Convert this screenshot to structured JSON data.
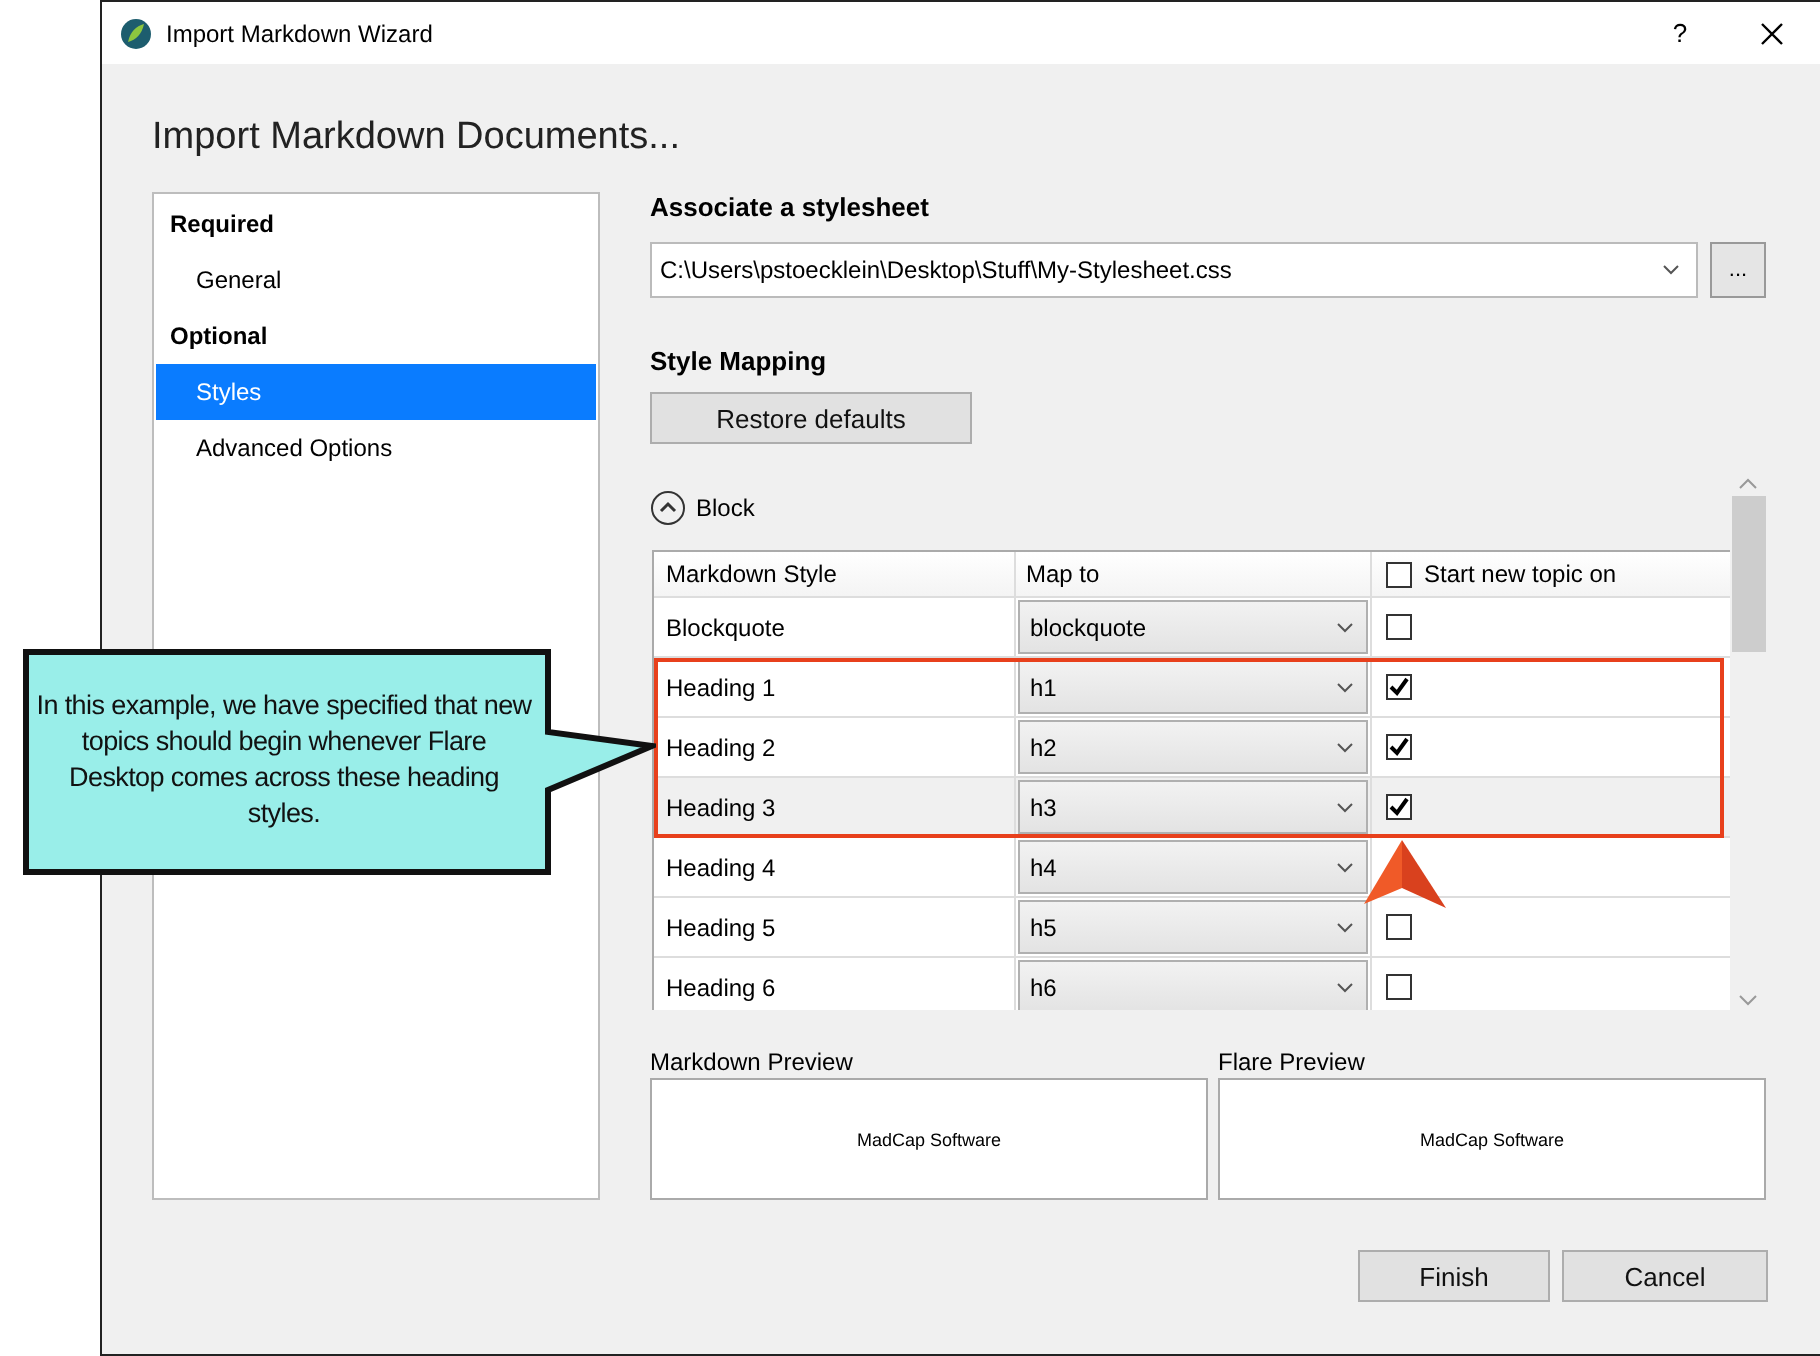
{
  "window": {
    "title": "Import Markdown Wizard",
    "help_button": "?"
  },
  "heading": "Import Markdown Documents...",
  "sidebar": {
    "groups": [
      {
        "label": "Required",
        "items": [
          {
            "label": "General",
            "selected": false
          }
        ]
      },
      {
        "label": "Optional",
        "items": [
          {
            "label": "Styles",
            "selected": true
          },
          {
            "label": "Advanced Options",
            "selected": false
          }
        ]
      }
    ]
  },
  "stylesheet": {
    "label": "Associate a stylesheet",
    "value": "C:\\Users\\pstoecklein\\Desktop\\Stuff\\My-Stylesheet.css",
    "browse_button": "..."
  },
  "style_mapping": {
    "label": "Style Mapping",
    "restore_button": "Restore defaults",
    "section": {
      "label": "Block",
      "expanded": true
    },
    "table": {
      "columns": [
        "Markdown Style",
        "Map to",
        "Start new topic on"
      ],
      "header_checked": false,
      "rows": [
        {
          "style": "Blockquote",
          "map_to": "blockquote",
          "checked": false,
          "selected": false,
          "highlighted": false
        },
        {
          "style": "Heading 1",
          "map_to": "h1",
          "checked": true,
          "selected": false,
          "highlighted": true
        },
        {
          "style": "Heading 2",
          "map_to": "h2",
          "checked": true,
          "selected": false,
          "highlighted": true
        },
        {
          "style": "Heading 3",
          "map_to": "h3",
          "checked": true,
          "selected": true,
          "highlighted": true
        },
        {
          "style": "Heading 4",
          "map_to": "h4",
          "selected": false,
          "highlighted": false
        },
        {
          "style": "Heading 5",
          "map_to": "h5",
          "checked": false,
          "selected": false,
          "highlighted": false
        },
        {
          "style": "Heading 6",
          "map_to": "h6",
          "checked": false,
          "selected": false,
          "highlighted": false
        }
      ]
    }
  },
  "previews": [
    {
      "label": "Markdown Preview",
      "content": "MadCap Software"
    },
    {
      "label": "Flare Preview",
      "content": "MadCap Software"
    }
  ],
  "buttons": [
    "Finish",
    "Cancel"
  ],
  "callout": {
    "text": "In this example, we have specified that new topics should begin whenever Flare Desktop comes across these heading styles."
  }
}
